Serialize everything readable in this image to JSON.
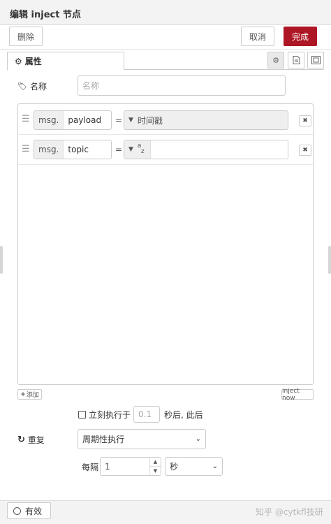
{
  "header": {
    "title": "编辑 inject 节点"
  },
  "toolbar": {
    "delete_label": "删除",
    "cancel_label": "取消",
    "done_label": "完成"
  },
  "tabs": {
    "properties_label": "属性"
  },
  "name_field": {
    "label": "名称",
    "placeholder": "名称"
  },
  "props": [
    {
      "prefix": "msg.",
      "key": "payload",
      "eq": "=",
      "type_label": "时间戳"
    },
    {
      "prefix": "msg.",
      "key": "topic",
      "eq": "=",
      "type_label": "",
      "type_icon_sup": "a",
      "type_icon_sub": "z"
    }
  ],
  "add_button": {
    "label": "添加"
  },
  "inject_now_button": {
    "label": "inject now"
  },
  "once": {
    "label": "立刻执行于",
    "delay_placeholder": "0.1",
    "suffix": "秒后, 此后"
  },
  "repeat": {
    "label": "重复",
    "mode": "周期性执行"
  },
  "interval": {
    "label": "每隔",
    "value": "1",
    "unit": "秒"
  },
  "footer": {
    "enabled_label": "有效"
  },
  "watermark": {
    "text": "知乎 @cytkfl技研"
  }
}
